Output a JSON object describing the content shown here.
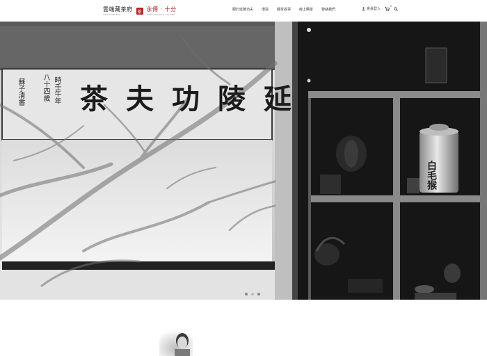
{
  "header": {
    "logo_primary": "雲端藏茶府",
    "logo_primary_sub": "YUN DUAN TEA",
    "logo_seal": "茶",
    "logo_secondary": "永傳 · 十分",
    "logo_secondary_sub": "YONG CHUAN & SHI FEN",
    "nav": [
      "關於延陵功夫",
      "環境",
      "藏茶故事",
      "線上購茶",
      "聯絡我們"
    ],
    "member_label": "會員登入",
    "cart_count": "0",
    "icons": {
      "user": "user-icon",
      "cart": "cart-icon",
      "search": "search-icon"
    }
  },
  "hero": {
    "scroll_title": [
      "茶",
      "夫",
      "功",
      "陵",
      "延"
    ],
    "inscription_col1": "八十四歲",
    "inscription_col2": "時壬午年",
    "inscription_col3": "蘇子清書",
    "tin_label": "白毛猴",
    "slide_count": 3,
    "active_slide": 1
  }
}
